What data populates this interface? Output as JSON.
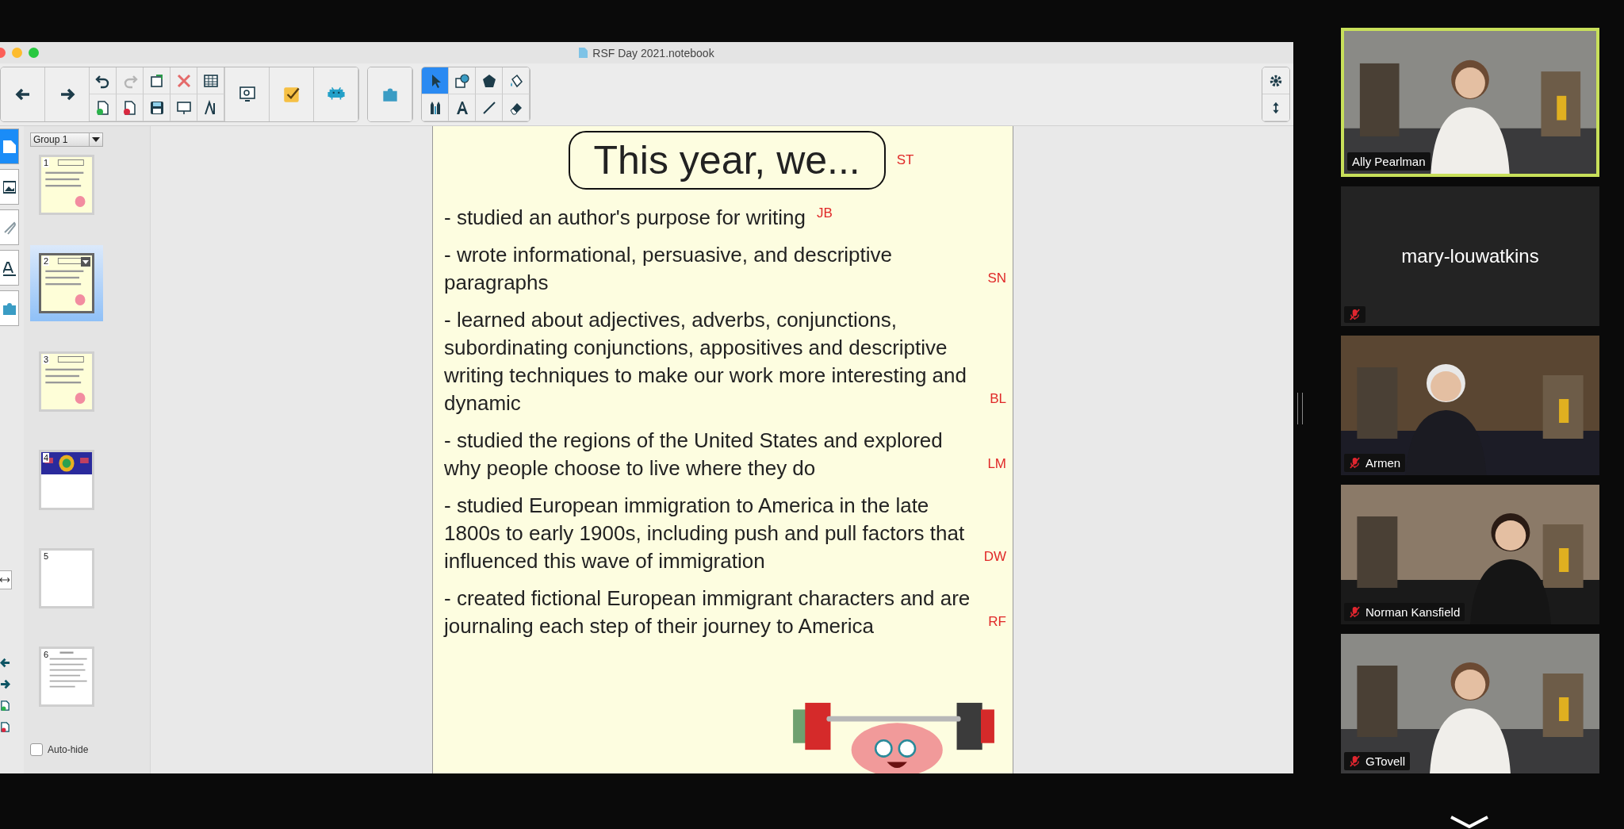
{
  "window": {
    "title": "RSF Day 2021.notebook"
  },
  "draw_tools": [
    {
      "kind": "pointer",
      "selected": true
    },
    {
      "kind": "shape",
      "selected": false
    },
    {
      "kind": "polygon",
      "selected": false
    },
    {
      "kind": "fill",
      "selected": false
    },
    {
      "kind": "pens",
      "selected": false
    },
    {
      "kind": "text",
      "selected": false
    },
    {
      "kind": "line",
      "selected": false
    },
    {
      "kind": "eraser",
      "selected": false
    }
  ],
  "sidebar": {
    "group": "Group 1",
    "pages": [
      {
        "number": "1",
        "kind": "cream",
        "selected": false
      },
      {
        "number": "2",
        "kind": "cream",
        "selected": true
      },
      {
        "number": "3",
        "kind": "cream",
        "selected": false
      },
      {
        "number": "4",
        "kind": "banner",
        "selected": false
      },
      {
        "number": "5",
        "kind": "blank",
        "selected": false
      },
      {
        "number": "6",
        "kind": "text",
        "selected": false
      }
    ],
    "auto_hide": {
      "label": "Auto-hide",
      "checked": false
    }
  },
  "slide": {
    "title": "This year, we...",
    "title_initials": "ST",
    "items": [
      {
        "text": "- studied an author's purpose for writing",
        "initials": "JB"
      },
      {
        "text": "- wrote informational, persuasive, and descriptive paragraphs",
        "initials": "SN"
      },
      {
        "text": "- learned about adjectives, adverbs, conjunctions, subordinating conjunctions, appositives and descriptive writing techniques to make our work more interesting and dynamic",
        "initials": "BL"
      },
      {
        "text": "- studied the regions of the United States and explored why people choose to live where they do",
        "initials": "LM"
      },
      {
        "text": "- studied European immigration to America in the late 1800s to early 1900s, including push and pull factors that influenced this wave of immigration",
        "initials": "DW"
      },
      {
        "text": "- created fictional European immigrant characters and are journaling each step of their journey to America",
        "initials": "RF"
      }
    ]
  },
  "participants": [
    {
      "name": "Ally Pearlman",
      "kind": "video",
      "speaking": true,
      "muted": false
    },
    {
      "name": "mary-louwatkins",
      "kind": "name",
      "speaking": false,
      "muted": true
    },
    {
      "name": "Armen",
      "kind": "video",
      "speaking": false,
      "muted": true
    },
    {
      "name": "Norman Kansfield",
      "kind": "video",
      "speaking": false,
      "muted": true
    },
    {
      "name": "GTovell",
      "kind": "video",
      "speaking": false,
      "muted": true
    }
  ]
}
